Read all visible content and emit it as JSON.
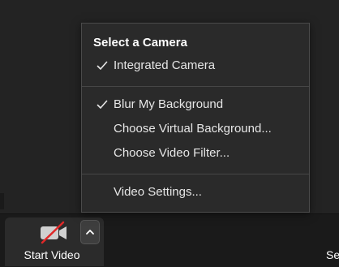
{
  "menu": {
    "heading": "Select a Camera",
    "sections": [
      [
        {
          "label": "Integrated Camera",
          "checked": true
        }
      ],
      [
        {
          "label": "Blur My Background",
          "checked": true
        },
        {
          "label": "Choose Virtual Background...",
          "checked": false
        },
        {
          "label": "Choose Video Filter...",
          "checked": false
        }
      ],
      [
        {
          "label": "Video Settings...",
          "checked": false
        }
      ]
    ]
  },
  "toolbar": {
    "start_video_label": "Start Video",
    "start_video_icon": "video-camera-off-icon",
    "caret_icon": "chevron-up-icon",
    "right_label_partial": "Se"
  },
  "colors": {
    "background": "#232323",
    "toolbar": "#1a1a1a",
    "menu": "#2a2a2a",
    "menu_text": "#e6e6e6",
    "video_off_slash": "#e02828"
  }
}
